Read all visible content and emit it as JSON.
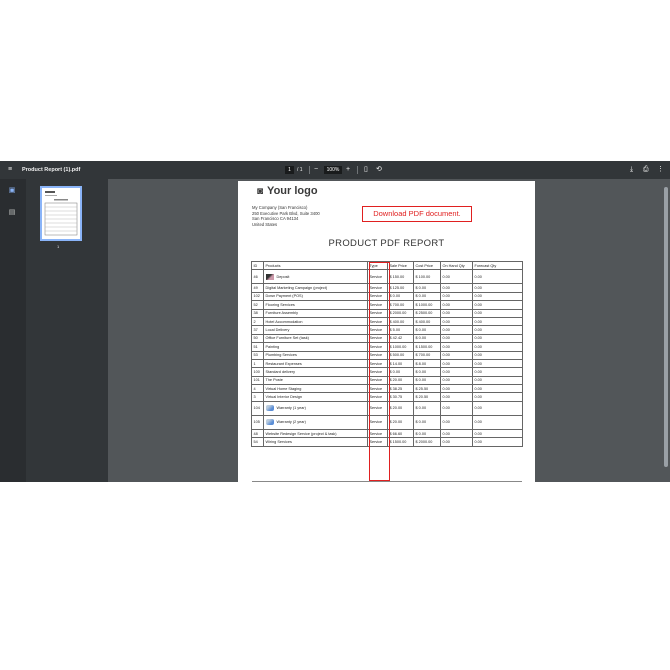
{
  "toolbar": {
    "title": "Product Report (1).pdf",
    "page_current": "1",
    "page_total": "/ 1",
    "zoom": "100%"
  },
  "sidebar": {
    "thumbnail_page": "1"
  },
  "document": {
    "logo_text": "Your logo",
    "company_lines": [
      "My Company (San Francisco)",
      "250 Executive Park Blvd, Suite 3400",
      "San Francisco CA 94134",
      "United States"
    ],
    "download_label": "Download PDF document.",
    "report_title": "PRODUCT PDF REPORT",
    "columns": [
      "ID",
      "Products",
      "Type",
      "Sale Price",
      "Cost Price",
      "On Hand Qty",
      "Forecast Qty"
    ],
    "rows": [
      {
        "id": "46",
        "name": "Deposit",
        "type": "Service",
        "sale": "$ 150.00",
        "cost": "$ 100.00",
        "onhand": "0.00",
        "forecast": "0.00",
        "icon": "deposit-icon"
      },
      {
        "id": "49",
        "name": "Digital Marketing Campaign (project)",
        "type": "Service",
        "sale": "$ 125.00",
        "cost": "$ 0.00",
        "onhand": "0.00",
        "forecast": "0.00"
      },
      {
        "id": "102",
        "name": "Down Payment (POS)",
        "type": "Service",
        "sale": "$ 0.00",
        "cost": "$ 0.00",
        "onhand": "0.00",
        "forecast": "0.00"
      },
      {
        "id": "52",
        "name": "Flooring Services",
        "type": "Service",
        "sale": "$ 700.00",
        "cost": "$ 1000.00",
        "onhand": "0.00",
        "forecast": "0.00"
      },
      {
        "id": "38",
        "name": "Furniture Assembly",
        "type": "Service",
        "sale": "$ 2000.00",
        "cost": "$ 2500.00",
        "onhand": "0.00",
        "forecast": "0.00"
      },
      {
        "id": "2",
        "name": "Hotel Accommodation",
        "type": "Service",
        "sale": "$ 400.00",
        "cost": "$ 400.00",
        "onhand": "0.00",
        "forecast": "0.00"
      },
      {
        "id": "37",
        "name": "Local Delivery",
        "type": "Service",
        "sale": "$ 5.00",
        "cost": "$ 0.00",
        "onhand": "0.00",
        "forecast": "0.00"
      },
      {
        "id": "50",
        "name": "Office Furniture Set (task)",
        "type": "Service",
        "sale": "$ 42.42",
        "cost": "$ 0.00",
        "onhand": "0.00",
        "forecast": "0.00"
      },
      {
        "id": "51",
        "name": "Painting",
        "type": "Service",
        "sale": "$ 1000.00",
        "cost": "$ 1500.00",
        "onhand": "0.00",
        "forecast": "0.00"
      },
      {
        "id": "53",
        "name": "Plumbing Services",
        "type": "Service",
        "sale": "$ 500.00",
        "cost": "$ 700.00",
        "onhand": "0.00",
        "forecast": "0.00"
      },
      {
        "id": "1",
        "name": "Restaurant Expenses",
        "type": "Service",
        "sale": "$ 14.00",
        "cost": "$ 8.00",
        "onhand": "0.00",
        "forecast": "0.00"
      },
      {
        "id": "100",
        "name": "Standard delivery",
        "type": "Service",
        "sale": "$ 0.00",
        "cost": "$ 0.00",
        "onhand": "0.00",
        "forecast": "0.00"
      },
      {
        "id": "101",
        "name": "The Poste",
        "type": "Service",
        "sale": "$ 20.00",
        "cost": "$ 0.00",
        "onhand": "0.00",
        "forecast": "0.00"
      },
      {
        "id": "4",
        "name": "Virtual Home Staging",
        "type": "Service",
        "sale": "$ 38.25",
        "cost": "$ 25.50",
        "onhand": "0.00",
        "forecast": "0.00"
      },
      {
        "id": "3",
        "name": "Virtual Interior Design",
        "type": "Service",
        "sale": "$ 30.75",
        "cost": "$ 20.50",
        "onhand": "0.00",
        "forecast": "0.00"
      },
      {
        "id": "104",
        "name": "Warranty (1 year)",
        "type": "Service",
        "sale": "$ 20.00",
        "cost": "$ 0.00",
        "onhand": "0.00",
        "forecast": "0.00",
        "icon": "warranty-icon"
      },
      {
        "id": "105",
        "name": "Warranty (2 year)",
        "type": "Service",
        "sale": "$ 20.00",
        "cost": "$ 0.00",
        "onhand": "0.00",
        "forecast": "0.00",
        "icon": "warranty-icon"
      },
      {
        "id": "48",
        "name": "Website Redesign Service (project & task)",
        "type": "Service",
        "sale": "$ 66.60",
        "cost": "$ 0.00",
        "onhand": "0.00",
        "forecast": "0.00"
      },
      {
        "id": "54",
        "name": "Wiring Services",
        "type": "Service",
        "sale": "$ 1500.00",
        "cost": "$ 2000.00",
        "onhand": "0.00",
        "forecast": "0.00"
      }
    ]
  },
  "colors": {
    "highlight": "#e02020",
    "toolbar_bg": "#323639",
    "viewer_bg": "#525659",
    "accent": "#8ab4f8"
  }
}
